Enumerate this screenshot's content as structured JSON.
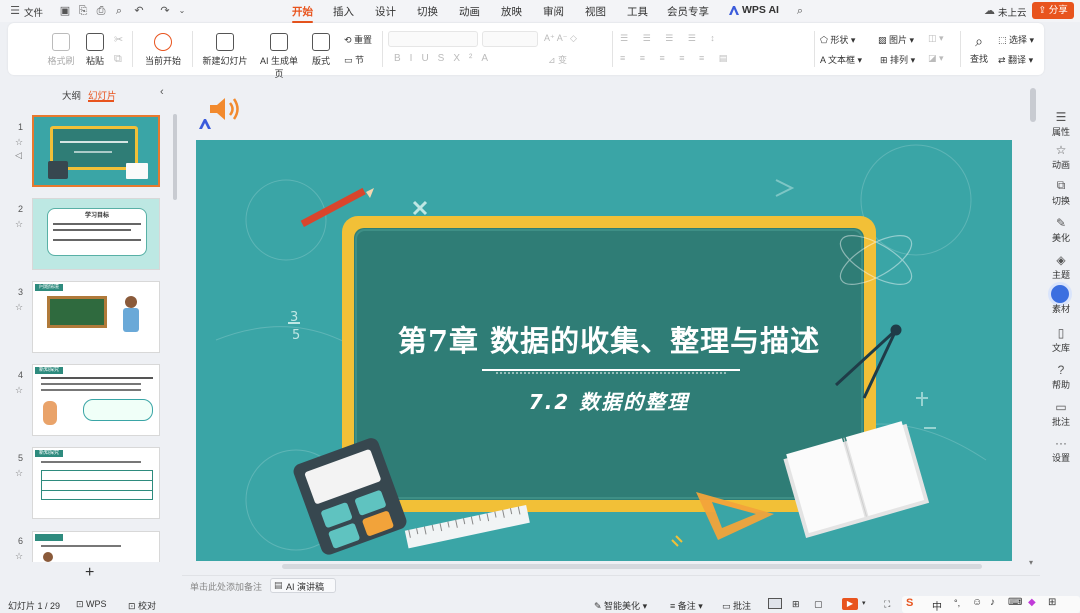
{
  "titlebar": {
    "file_menu": "文件",
    "tabs": [
      "开始",
      "插入",
      "设计",
      "切换",
      "动画",
      "放映",
      "审阅",
      "视图",
      "工具",
      "会员专享",
      "WPS AI"
    ],
    "active_tab": "开始",
    "cloud_label": "未上云",
    "share_label": "分享"
  },
  "ribbon": {
    "format_painter": "格式刷",
    "paste": "粘贴",
    "play_from_current": "当前开始",
    "new_slide": "新建幻灯片",
    "ai_single_page": "AI 生成单页",
    "layout": "版式",
    "reset": "重置",
    "section": "节",
    "shape": "形状",
    "picture": "图片",
    "textbox": "文本框",
    "arrange": "排列",
    "find": "查找",
    "select": "选择",
    "translate": "翻译"
  },
  "left_panel": {
    "outline_tab": "大纲",
    "slides_tab": "幻灯片",
    "add_label": "+",
    "slide_numbers": [
      "1",
      "2",
      "3",
      "4",
      "5",
      "6"
    ]
  },
  "slide": {
    "title": "第7章  数据的收集、整理与描述",
    "subtitle": "7.2  数据的整理",
    "fraction_num": "3",
    "fraction_den": "5"
  },
  "thumbnails": {
    "t2_title": "学习目标",
    "t3_tag": "问题情境",
    "t4_tag": "新知探究",
    "t5_tag": "新知探究"
  },
  "notes": {
    "placeholder": "单击此处添加备注",
    "ai_speech": "AI 演讲稿"
  },
  "right_sidebar": [
    "属性",
    "动画",
    "切换",
    "美化",
    "主题",
    "素材",
    "文库",
    "帮助",
    "批注",
    "设置"
  ],
  "statusbar": {
    "slide_info": "幻灯片 1 / 29",
    "wps": "WPS",
    "proofread": "校对",
    "smart_beautify": "智能美化",
    "notes": "备注",
    "comments": "批注",
    "ime": "中"
  },
  "colors": {
    "accent": "#e8541e",
    "slide_bg": "#3aa5a6",
    "board": "#2f7d76",
    "frame": "#f2c037"
  }
}
